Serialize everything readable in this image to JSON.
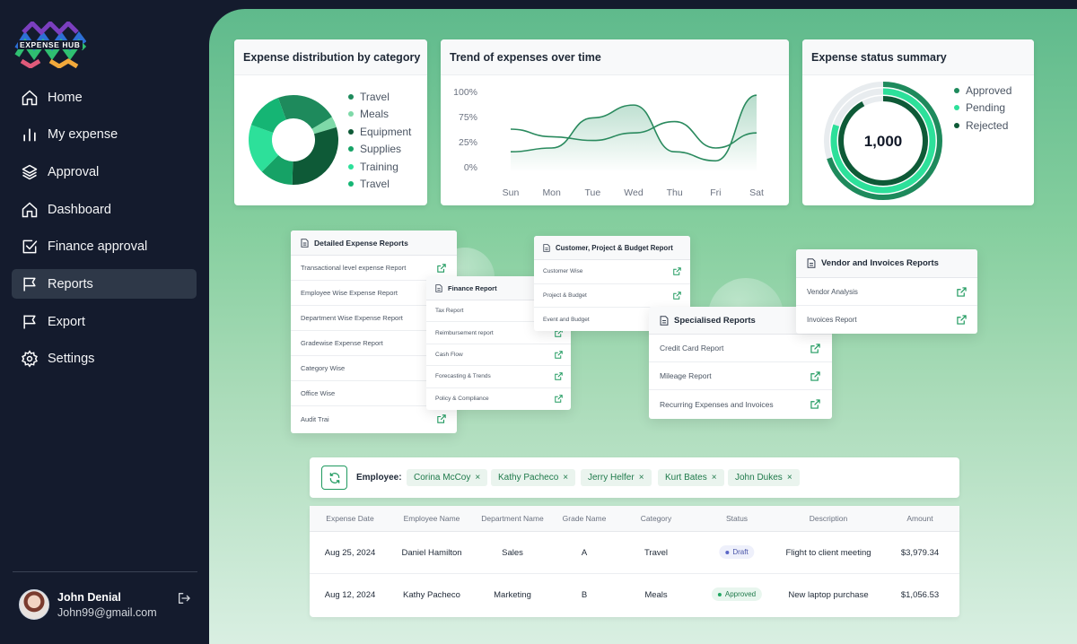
{
  "app": {
    "logo_text": "EXPENSE HUB"
  },
  "sidebar": {
    "items": [
      {
        "label": "Home",
        "icon": "home-icon"
      },
      {
        "label": "My expense",
        "icon": "bar-chart-icon"
      },
      {
        "label": "Approval",
        "icon": "layers-icon"
      },
      {
        "label": "Dashboard",
        "icon": "home-icon"
      },
      {
        "label": "Finance approval",
        "icon": "checkbox-icon"
      },
      {
        "label": "Reports",
        "icon": "flag-icon",
        "active": true
      },
      {
        "label": "Export",
        "icon": "flag-icon"
      },
      {
        "label": "Settings",
        "icon": "gear-icon"
      }
    ],
    "user": {
      "name": "John Denial",
      "email": "John99@gmail.com"
    }
  },
  "cards": {
    "distribution": {
      "title": "Expense distribution by category",
      "legend": [
        {
          "label": "Travel",
          "color": "#1e8a5c"
        },
        {
          "label": "Meals",
          "color": "#7ed9a8"
        },
        {
          "label": "Equipment",
          "color": "#0e5a37"
        },
        {
          "label": "Supplies",
          "color": "#16a266"
        },
        {
          "label": "Training",
          "color": "#2de09a"
        },
        {
          "label": "Travel",
          "color": "#15b574"
        }
      ]
    },
    "trend": {
      "title": "Trend of expenses over time"
    },
    "status": {
      "title": "Expense status summary",
      "center_value": "1,000",
      "legend": [
        {
          "label": "Approved",
          "color": "#1e8a5c"
        },
        {
          "label": "Pending",
          "color": "#2de09a"
        },
        {
          "label": "Rejected",
          "color": "#0e5a37"
        }
      ]
    }
  },
  "chart_data": [
    {
      "type": "pie",
      "title": "Expense distribution by category",
      "labels": [
        "Travel",
        "Meals",
        "Equipment",
        "Supplies",
        "Training",
        "Travel"
      ],
      "values": [
        22,
        4,
        30,
        12,
        18,
        14
      ],
      "colors": [
        "#1e8a5c",
        "#7ed9a8",
        "#0e5a37",
        "#16a266",
        "#2de09a",
        "#15b574"
      ]
    },
    {
      "type": "line",
      "title": "Trend of expenses over time",
      "categories": [
        "Sun",
        "Mon",
        "Tue",
        "Wed",
        "Thu",
        "Fri",
        "Sat"
      ],
      "yticks": [
        "100%",
        "75%",
        "25%",
        "0%"
      ],
      "ylim": [
        0,
        100
      ],
      "series": [
        {
          "values": [
            20,
            25,
            65,
            82,
            20,
            8,
            95
          ]
        },
        {
          "values": [
            50,
            40,
            35,
            45,
            60,
            25,
            45
          ]
        }
      ]
    },
    {
      "type": "pie",
      "title": "Expense status summary",
      "labels": [
        "Approved",
        "Pending",
        "Rejected"
      ],
      "values": [
        70,
        80,
        92
      ],
      "colors": [
        "#1e8a5c",
        "#2de09a",
        "#0e5a37"
      ]
    }
  ],
  "reports": {
    "detailed": {
      "title": "Detailed Expense Reports",
      "items": [
        "Transactional level expense Report",
        "Employee Wise Expense Report",
        "Department Wise Expense Report",
        "Gradewise Expense Report",
        "Category Wise",
        "Office Wise",
        "Audit Trai"
      ]
    },
    "finance": {
      "title": "Finance Report",
      "items": [
        "Tax Report",
        "Reimbursement report",
        "Cash Flow",
        "Forecasting & Trends",
        "Policy & Compliance"
      ]
    },
    "customer": {
      "title": "Customer, Project & Budget Report",
      "items": [
        "Customer Wise",
        "Project & Budget",
        "Event and Budget"
      ]
    },
    "specialised": {
      "title": "Specialised Reports",
      "items": [
        "Credit Card Report",
        "Mileage Report",
        "Recurring Expenses and Invoices"
      ]
    },
    "vendor": {
      "title": "Vendor and Invoices Reports",
      "items": [
        "Vendor Analysis",
        "Invoices Report"
      ]
    }
  },
  "filter": {
    "label": "Employee:",
    "chips": [
      "Corina McCoy",
      "Kathy Pacheco",
      "Jerry Helfer",
      "Kurt Bates",
      "John Dukes"
    ]
  },
  "table": {
    "columns": [
      "Expense Date",
      "Employee Name",
      "Department Name",
      "Grade Name",
      "Category",
      "Status",
      "Description",
      "Amount"
    ],
    "rows": [
      {
        "date": "Aug 25, 2024",
        "employee": "Daniel Hamilton",
        "department": "Sales",
        "grade": "A",
        "category": "Travel",
        "status": "Draft",
        "description": "Flight to client meeting",
        "amount": "$3,979.34"
      },
      {
        "date": "Aug 12, 2024",
        "employee": "Kathy Pacheco",
        "department": "Marketing",
        "grade": "B",
        "category": "Meals",
        "status": "Approved",
        "description": "New laptop purchase",
        "amount": "$1,056.53"
      }
    ]
  }
}
